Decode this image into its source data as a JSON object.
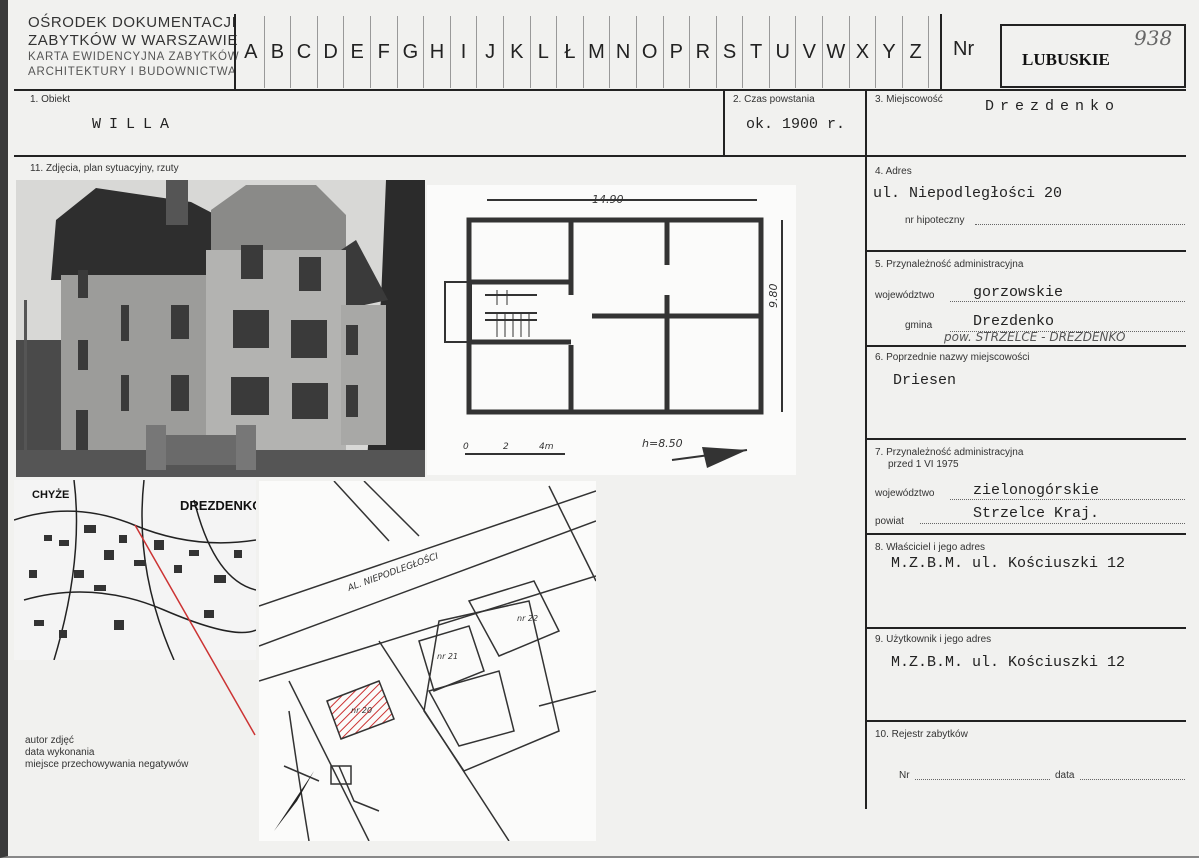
{
  "header": {
    "institution_line1": "OŚRODEK DOKUMENTACJI",
    "institution_line2": "ZABYTKÓW W WARSZAWIE",
    "institution_line3": "KARTA EWIDENCYJNA ZABYTKÓW",
    "institution_line4": "ARCHITEKTURY I BUDOWNICTWA",
    "letters": [
      "A",
      "B",
      "C",
      "D",
      "E",
      "F",
      "G",
      "H",
      "I",
      "J",
      "K",
      "L",
      "Ł",
      "M",
      "N",
      "O",
      "P",
      "R",
      "S",
      "T",
      "U",
      "V",
      "W",
      "X",
      "Y",
      "Z"
    ],
    "nr_label": "Nr",
    "region": "LUBUSKIE",
    "handwritten_number": "938"
  },
  "fields": {
    "object": {
      "label": "1. Obiekt",
      "value": "WILLA"
    },
    "date": {
      "label": "2. Czas powstania",
      "value": "ok. 1900 r."
    },
    "place": {
      "label": "3. Miejscowość",
      "value": "Drezdenko"
    },
    "address": {
      "label": "4. Adres",
      "value": "ul. Niepodległości 20",
      "mortgage_label": "nr hipoteczny"
    },
    "admin": {
      "label": "5. Przynależność administracyjna",
      "voiv_label": "województwo",
      "voiv_value": "gorzowskie",
      "gmina_label": "gmina",
      "gmina_value": "Drezdenko",
      "hand_note": "pow. STRZELCE - DREZDENKO"
    },
    "former_names": {
      "label": "6. Poprzednie nazwy miejscowości",
      "value": "Driesen"
    },
    "admin_before": {
      "label1": "7. Przynależność administracyjna",
      "label2": "przed 1 VI 1975",
      "voiv_label": "województwo",
      "voiv_value": "zielonogórskie",
      "powiat_label": "powiat",
      "powiat_value": "Strzelce Kraj."
    },
    "owner": {
      "label": "8. Właściciel i jego adres",
      "value": "M.Z.B.M. ul. Kościuszki 12"
    },
    "user": {
      "label": "9. Użytkownik i jego adres",
      "value": "M.Z.B.M. ul. Kościuszki 12"
    },
    "registry": {
      "label": "10. Rejestr zabytków",
      "nr_label": "Nr",
      "date_label": "data"
    },
    "photos_label": "11. Zdjęcia, plan sytuacyjny, rzuty",
    "photo_meta": [
      "autor zdjęć",
      "data wykonania",
      "miejsce przechowywania negatywów"
    ]
  },
  "plan": {
    "width_dim": "14.90",
    "depth_dim": "9.80",
    "height": "h=8.50",
    "scale": [
      "0",
      "2",
      "4m"
    ]
  },
  "map": {
    "label_left": "CHYŻE",
    "label_right": "DREZDENKO"
  },
  "situation": {
    "street": "AL. NIEPODLEGŁOŚCI",
    "house_main": "nr 20",
    "house_2": "nr 21",
    "house_3": "nr 22"
  }
}
